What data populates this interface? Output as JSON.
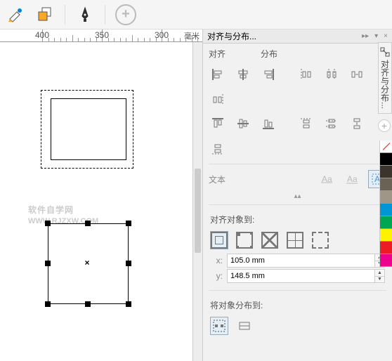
{
  "toolbar": {
    "fill_interactive": "interactive-fill-tool",
    "smart_fill": "smart-fill-tool",
    "pen": "pen-tool",
    "add": "add-tool"
  },
  "ruler": {
    "unit": "毫米",
    "ticks": [
      {
        "pos": 60,
        "label": "400"
      },
      {
        "pos": 145,
        "label": "350"
      },
      {
        "pos": 230,
        "label": "300"
      }
    ]
  },
  "watermark": {
    "line1": "软件自学网",
    "line2": "WWW.RJZXW.COM"
  },
  "panel": {
    "title": "对齐与分布...",
    "tab_align": "对齐",
    "tab_distribute": "分布",
    "section_text": "文本",
    "align_to_label": "对齐对象到:",
    "x_label": "x:",
    "y_label": "y:",
    "x_value": "105.0 mm",
    "y_value": "148.5 mm",
    "distribute_to_label": "将对象分布到:"
  },
  "sidetab": {
    "label": "对齐与分布..."
  },
  "swatches": [
    "none",
    "#000000",
    "#3a342c",
    "#6b6256",
    "#a09688",
    "#0096d6",
    "#00a651",
    "#fff200",
    "#ed1c24",
    "#ec008c"
  ]
}
